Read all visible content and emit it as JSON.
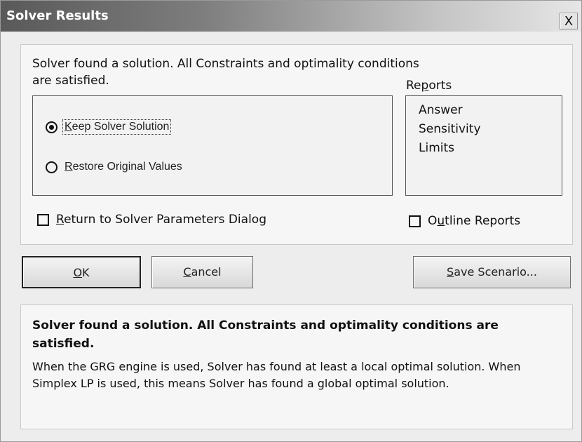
{
  "window": {
    "title": "Solver Results",
    "close_symbol": "X"
  },
  "message": {
    "top": "Solver found a solution.  All Constraints and optimality conditions are satisfied."
  },
  "options": {
    "keep_prefix": "",
    "keep_accel": "K",
    "keep_rest": "eep Solver Solution",
    "restore_accel": "R",
    "restore_rest": "estore Original Values",
    "selected": "keep"
  },
  "reports": {
    "label_prefix": "Re",
    "label_accel": "p",
    "label_rest": "orts",
    "items": [
      "Answer",
      "Sensitivity",
      "Limits"
    ]
  },
  "checkboxes": {
    "return_accel": "R",
    "return_rest": "eturn to Solver Parameters Dialog",
    "return_checked": false,
    "outline_prefix": "O",
    "outline_accel": "u",
    "outline_rest": "tline Reports",
    "outline_checked": false
  },
  "buttons": {
    "ok_accel": "O",
    "ok_rest": "K",
    "cancel_accel": "C",
    "cancel_rest": "ancel",
    "save_accel": "S",
    "save_rest": "ave Scenario..."
  },
  "description": {
    "bold": "Solver found a solution.  All Constraints and optimality conditions are satisfied.",
    "body": "When the GRG engine is used, Solver has found at least a local optimal solution. When Simplex LP is used, this means Solver has found a global optimal solution."
  }
}
